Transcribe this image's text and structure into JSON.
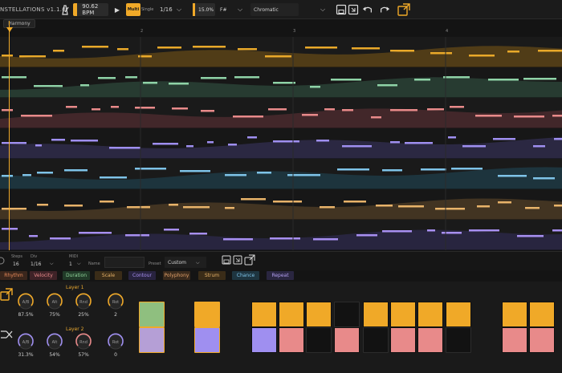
{
  "toolbar": {
    "title": "NSTELLATIONS v1.1.0",
    "bpm": "90.62 BPM",
    "multi_label": "Multi",
    "single_label": "Single",
    "rate": "1/16",
    "swing": "15.0%",
    "key": "F#",
    "scale": "Chromatic"
  },
  "arranger": {
    "harmony_label": "Harmony",
    "ruler": [
      "2",
      "3",
      "4"
    ],
    "lane_colors": [
      "#e9a92a",
      "#8fd3a7",
      "#e88a8a",
      "#9f8ff0",
      "#7ec3e8",
      "#e8b36a",
      "#a78ff0"
    ],
    "lane_fills": [
      "#5a4318",
      "#2a4236",
      "#4a2a2e",
      "#2f2b4a",
      "#1f3a44",
      "#4a3a24",
      "#2c2846"
    ]
  },
  "controls": {
    "steps_label": "Steps",
    "steps_value": "16",
    "div_label": "Div",
    "div_value": "1/16",
    "midi_label": "MIDI",
    "midi_value": "1",
    "name_label": "Name",
    "preset_label": "Preset",
    "preset_value": "Custom"
  },
  "tabs": [
    {
      "label": "Rhythm",
      "color": "#e88a5a",
      "bg": "#3a261c"
    },
    {
      "label": "Velocity",
      "color": "#e88a8a",
      "bg": "#3e2227"
    },
    {
      "label": "Duration",
      "color": "#8fd39a",
      "bg": "#213a28"
    },
    {
      "label": "Scale",
      "color": "#e8b36a",
      "bg": "#3a2c18"
    },
    {
      "label": "Contour",
      "color": "#a78ff0",
      "bg": "#28233f"
    },
    {
      "label": "Polyphony",
      "color": "#e0a06a",
      "bg": "#3a2a1c"
    },
    {
      "label": "Strum",
      "color": "#e8b36a",
      "bg": "#3a2c18"
    },
    {
      "label": "Chance",
      "color": "#7ec3e8",
      "bg": "#1e3540"
    },
    {
      "label": "Repeat",
      "color": "#b39ff0",
      "bg": "#2a2640"
    }
  ],
  "layers": [
    {
      "title": "Layer 1",
      "knobs": [
        {
          "name": "A/B",
          "value": "87.5%",
          "color": "#f0a928"
        },
        {
          "name": "Alt",
          "value": "75%",
          "color": "#f0a928"
        },
        {
          "name": "Rnd",
          "value": "25%",
          "color": "#f0a928"
        },
        {
          "name": "Rot",
          "value": "2",
          "color": "#f0a928"
        }
      ]
    },
    {
      "title": "Layer 2",
      "knobs": [
        {
          "name": "A/B",
          "value": "31.3%",
          "color": "#9f8ff0"
        },
        {
          "name": "Alt",
          "value": "54%",
          "color": "#9f8ff0"
        },
        {
          "name": "Rnd",
          "value": "57%",
          "color": "#e88a8a"
        },
        {
          "name": "Rot",
          "value": "0",
          "color": "#9f8ff0"
        }
      ]
    }
  ],
  "grid": {
    "top_row": [
      "green",
      "",
      "orange",
      "",
      "orange",
      "orange",
      "orange",
      "dark",
      "orange",
      "orange",
      "orange",
      "orange",
      "",
      "orange",
      "orange"
    ],
    "bottom_row": [
      "lavender",
      "",
      "purple",
      "",
      "purple",
      "red",
      "dark",
      "red",
      "dark",
      "red",
      "red",
      "dark",
      "",
      "red",
      "red"
    ],
    "colors": {
      "green": "#8fbf7f",
      "orange": "#f0a928",
      "purple": "#9f8ff0",
      "lavender": "#b59fd6",
      "red": "#e88a8a",
      "dark": "#121212"
    }
  }
}
